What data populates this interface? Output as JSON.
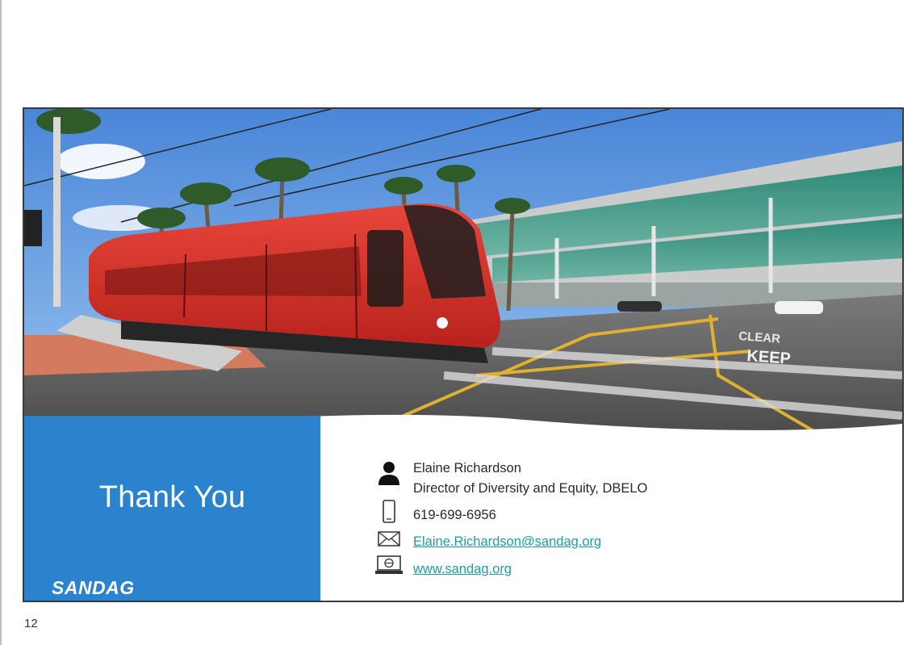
{
  "slide": {
    "heading": "Thank You",
    "logo_text": "SANDAG",
    "photo_road_text_1": "KEEP",
    "photo_road_text_2": "CLEAR",
    "colors": {
      "panel_blue": "#2b83cd",
      "link_teal": "#1f9aa8",
      "trolley_red": "#e23a2e"
    }
  },
  "contact": {
    "name": "Elaine Richardson",
    "title": "Director of Diversity and Equity, DBELO",
    "phone": "619-699-6956",
    "email": "Elaine.Richardson@sandag.org",
    "website": "www.sandag.org",
    "icons": {
      "person": "person-icon",
      "phone": "mobile-phone-icon",
      "email": "envelope-icon",
      "web": "laptop-icon"
    }
  },
  "page_number": "12"
}
